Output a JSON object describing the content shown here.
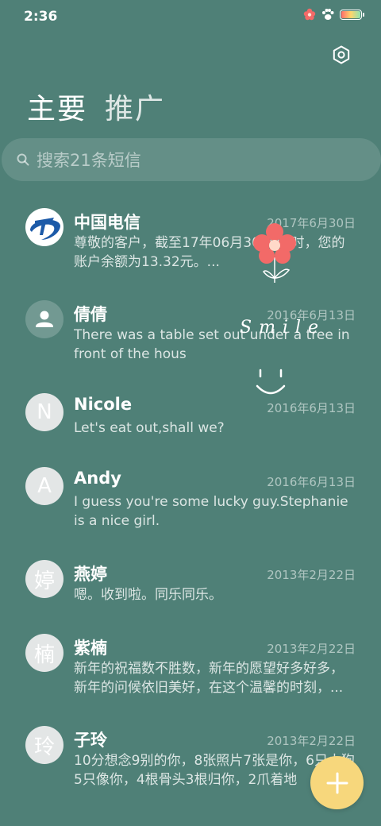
{
  "status_bar": {
    "time": "2:36",
    "icons": [
      "flower-icon",
      "paw-icon",
      "battery-icon"
    ]
  },
  "header": {
    "settings_icon": "settings-icon",
    "tabs": [
      {
        "label": "主要",
        "active": true
      },
      {
        "label": "推广",
        "active": false
      }
    ]
  },
  "search": {
    "placeholder": "搜索21条短信",
    "icon": "search-icon"
  },
  "conversations": [
    {
      "name": "中国电信",
      "date": "2017年6月30日",
      "preview": "尊敬的客户，截至17年06月30日15时，您的账户余额为13.32元。...",
      "avatar_type": "telecom-logo",
      "avatar_text": ""
    },
    {
      "name": "倩倩",
      "date": "2016年6月13日",
      "preview": "There was a table set out under a tree in front of the hous",
      "avatar_type": "person",
      "avatar_text": ""
    },
    {
      "name": "Nicole",
      "date": "2016年6月13日",
      "preview": "Let's eat out,shall we?",
      "avatar_type": "letter",
      "avatar_text": "N"
    },
    {
      "name": "Andy",
      "date": "2016年6月13日",
      "preview": "I guess you're some lucky guy.Stephanie is a nice girl.",
      "avatar_type": "letter",
      "avatar_text": "A"
    },
    {
      "name": "燕婷",
      "date": "2013年2月22日",
      "preview": "嗯。收到啦。同乐同乐。",
      "avatar_type": "letter",
      "avatar_text": "婷"
    },
    {
      "name": "紫楠",
      "date": "2013年2月22日",
      "preview": "新年的祝福数不胜数，新年的愿望好多好多，新年的问候依旧美好，在这个温馨的时刻，...",
      "avatar_type": "letter",
      "avatar_text": "楠"
    },
    {
      "name": "子玲",
      "date": "2013年2月22日",
      "preview": "10分想念9别的你，8张照片7张是你，6只小狗5只像你，4根骨头3根归你，2爪着地",
      "avatar_type": "letter",
      "avatar_text": "玲"
    }
  ],
  "decoration": {
    "text": "Smile",
    "colors": {
      "petal": "#f26a68",
      "center": "#ffd9c9"
    }
  },
  "fab": {
    "icon": "plus-icon",
    "color": "#f7d77c"
  },
  "colors": {
    "background": "#4f8077",
    "accent": "#f7d77c"
  }
}
